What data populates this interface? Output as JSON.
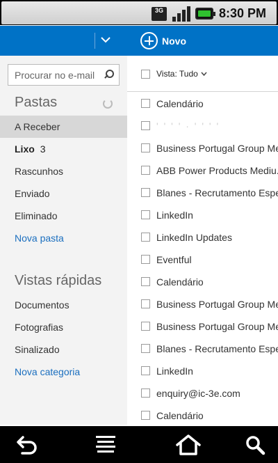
{
  "status_bar": {
    "network_label": "3G",
    "time": "8:30 PM"
  },
  "header": {
    "account_name": "",
    "new_label": "Novo"
  },
  "search": {
    "placeholder": "Procurar no e-mail"
  },
  "folders": {
    "title": "Pastas",
    "items": [
      {
        "label": "A Receber",
        "count": ""
      },
      {
        "label": "Lixo",
        "count": "3"
      },
      {
        "label": "Rascunhos",
        "count": ""
      },
      {
        "label": "Enviado",
        "count": ""
      },
      {
        "label": "Eliminado",
        "count": ""
      }
    ],
    "new_folder_label": "Nova pasta"
  },
  "quick_views": {
    "title": "Vistas rápidas",
    "items": [
      {
        "label": "Documentos"
      },
      {
        "label": "Fotografias"
      },
      {
        "label": "Sinalizado"
      }
    ],
    "new_category_label": "Nova categoria"
  },
  "message_list": {
    "view_filter_label": "Vista: Tudo",
    "messages": [
      {
        "from": "Calendário"
      },
      {
        "from": "' ' ' ' · ' ' ' '"
      },
      {
        "from": "Business Portugal Group Me"
      },
      {
        "from": "ABB Power Products Mediu..."
      },
      {
        "from": "Blanes - Recrutamento Espe"
      },
      {
        "from": "LinkedIn"
      },
      {
        "from": "LinkedIn Updates"
      },
      {
        "from": "Eventful"
      },
      {
        "from": "Calendário"
      },
      {
        "from": "Business Portugal Group Me"
      },
      {
        "from": "Business Portugal Group Me"
      },
      {
        "from": "Blanes - Recrutamento Espe"
      },
      {
        "from": "LinkedIn"
      },
      {
        "from": "enquiry@ic-3e.com"
      },
      {
        "from": "Calendário"
      }
    ]
  },
  "colors": {
    "brand_blue": "#0072c6",
    "link_blue": "#1b6fbf",
    "active_folder_bg": "#d7d7d7",
    "left_pane_bg": "#f3f3f3"
  },
  "icons": [
    "signal-icon",
    "battery-icon",
    "chevron-down-icon",
    "plus-circle-icon",
    "search-icon",
    "refresh-icon",
    "back-icon",
    "menu-icon",
    "home-icon",
    "search-icon"
  ]
}
